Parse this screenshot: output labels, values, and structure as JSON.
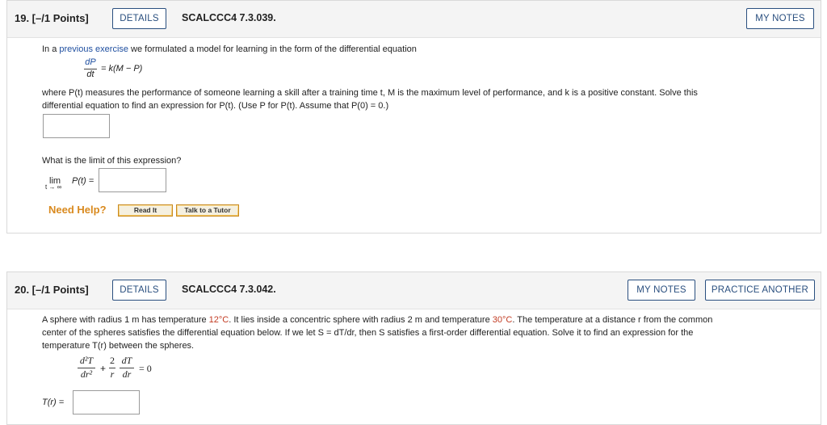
{
  "q19": {
    "number": "19. [–/1 Points]",
    "details": "DETAILS",
    "code": "SCALCCC4 7.3.039.",
    "my_notes": "MY NOTES",
    "intro_a": "In a ",
    "intro_link": "previous exercise",
    "intro_b": " we formulated a model for learning in the form of the differential equation",
    "eq_num": "dP",
    "eq_den": "dt",
    "eq_rhs": "= k(M − P)",
    "desc_line1": "where P(t) measures the performance of someone learning a skill after a training time t, M is the maximum level of performance, and k is a positive constant. Solve this",
    "desc_line2": "differential equation to find an expression for  P(t).  (Use P for P(t). Assume that P(0) = 0.)",
    "limit_question": "What is the limit of this expression?",
    "lim_word": "lim",
    "lim_sub": "t → ∞",
    "lim_expr": "P(t) =",
    "need_help": "Need Help?",
    "read_it": "Read It",
    "talk_tutor": "Talk to a Tutor"
  },
  "q20": {
    "number": "20. [–/1 Points]",
    "details": "DETAILS",
    "code": "SCALCCC4 7.3.042.",
    "my_notes": "MY NOTES",
    "practice": "PRACTICE ANOTHER",
    "t1a": "A sphere with radius 1 m has temperature ",
    "t1_temp1": "12°C",
    "t1b": ". It lies inside a concentric sphere with radius 2 m and temperature ",
    "t1_temp2": "30°C",
    "t1c": ". The temperature at a distance r from the common",
    "line2": "center of the spheres satisfies the differential equation below. If we let S = dT/dr, then S satisfies a first-order differential equation. Solve it to find an expression for the",
    "line3": "temperature T(r) between the spheres.",
    "eq_n1": "d²T",
    "eq_d1": "dr²",
    "eq_plus": "+",
    "eq_n2": "2",
    "eq_d2": "r",
    "eq_n3": "dT",
    "eq_d3": "dr",
    "eq_rhs": "= 0",
    "answer_label": "T(r) ="
  }
}
